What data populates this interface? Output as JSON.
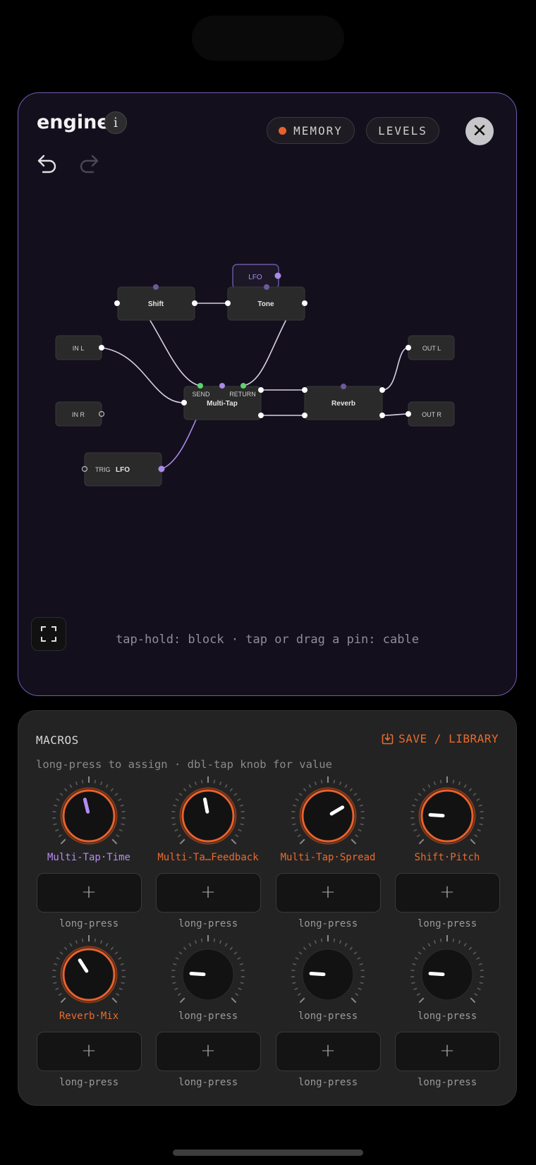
{
  "engine": {
    "title": "engine",
    "info_label": "i",
    "memory_label": "MEMORY",
    "levels_label": "LEVELS",
    "close_label": "✕",
    "hint": "tap-hold: block · tap or drag a pin: cable",
    "nodes": {
      "lfo_small": "LFO",
      "shift": "Shift",
      "tone": "Tone",
      "in_l": "IN L",
      "in_r": "IN R",
      "out_l": "OUT L",
      "out_r": "OUT R",
      "multitap": "Multi-Tap",
      "send": "SEND",
      "return": "RETURN",
      "reverb": "Reverb",
      "trig": "TRIG",
      "lfo": "LFO"
    }
  },
  "macros": {
    "title": "MACROS",
    "save_label": "SAVE / LIBRARY",
    "hint": "long-press to assign · dbl-tap knob for value",
    "slot_plus": "+",
    "knobs_row1": [
      {
        "label": "Multi-Tap·Time",
        "assigned": true,
        "value": 0.45,
        "color": "#b48cf2"
      },
      {
        "label": "Multi-Ta…Feedback",
        "assigned": true,
        "value": 0.46,
        "color": "#ea6b2d"
      },
      {
        "label": "Multi-Tap·Spread",
        "assigned": true,
        "value": 0.72,
        "color": "#ea6b2d"
      },
      {
        "label": "Shift·Pitch",
        "assigned": true,
        "value": 0.18,
        "color": "#ea6b2d"
      }
    ],
    "slots_row1": [
      "long-press",
      "long-press",
      "long-press",
      "long-press"
    ],
    "knobs_row2": [
      {
        "label": "Reverb·Mix",
        "assigned": true,
        "value": 0.38,
        "color": "#ea6b2d"
      },
      {
        "label": "long-press",
        "assigned": false,
        "value": 0.18,
        "color": "#9a9a9a"
      },
      {
        "label": "long-press",
        "assigned": false,
        "value": 0.18,
        "color": "#9a9a9a"
      },
      {
        "label": "long-press",
        "assigned": false,
        "value": 0.18,
        "color": "#9a9a9a"
      }
    ],
    "slots_row2": [
      "long-press",
      "long-press",
      "long-press",
      "long-press"
    ]
  },
  "colors": {
    "accent": "#ea6b2d",
    "purple": "#b48cf2",
    "green": "#5bd36e",
    "panel_border": "#6f5bb3"
  }
}
